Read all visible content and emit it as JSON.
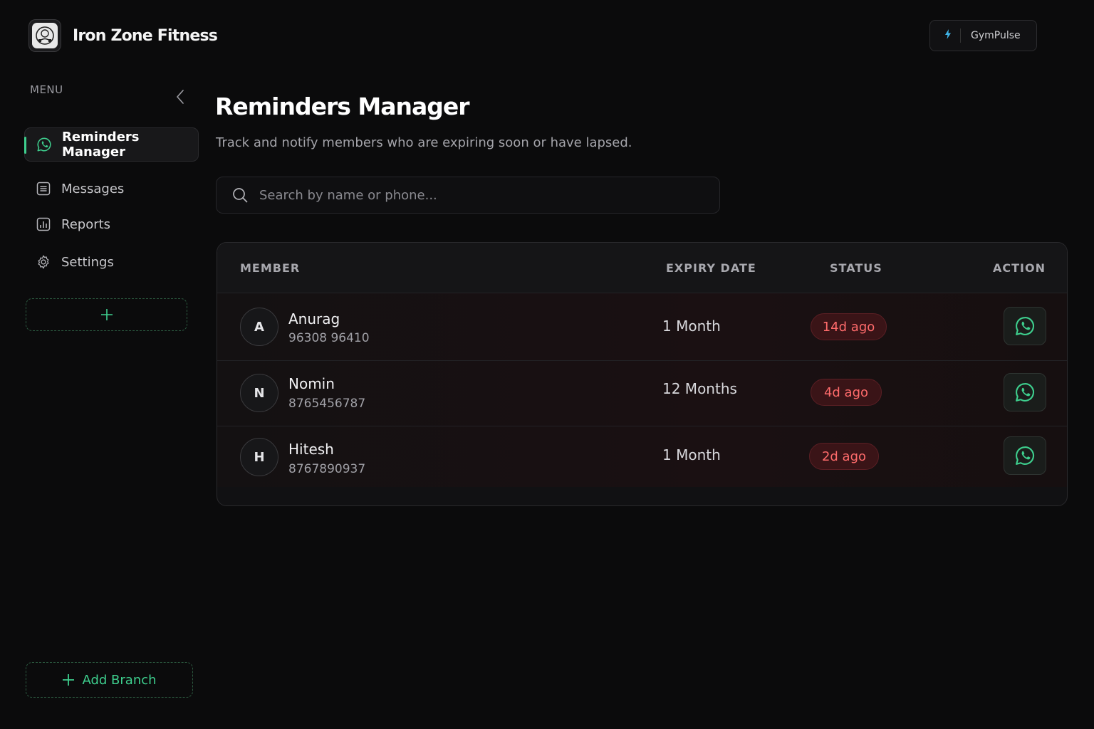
{
  "brand": {
    "name": "Iron Zone Fitness"
  },
  "top_badge": {
    "icon": "bolt-icon",
    "label": "GymPulse"
  },
  "sidebar": {
    "menu_label": "MENU",
    "items": [
      {
        "label": "Reminders Manager",
        "icon": "whatsapp-icon",
        "active": true
      },
      {
        "label": "Messages",
        "icon": "document-icon",
        "active": false
      },
      {
        "label": "Reports",
        "icon": "bar-chart-icon",
        "active": false
      },
      {
        "label": "Settings",
        "icon": "gear-icon",
        "active": false
      }
    ],
    "add_branch_label": "Add Branch"
  },
  "main": {
    "title": "Reminders Manager",
    "subtitle": "Track and notify members who are expiring soon or have lapsed.",
    "search": {
      "placeholder": "Search by name or phone..."
    }
  },
  "table": {
    "columns": [
      "MEMBER",
      "EXPIRY DATE",
      "STATUS",
      "ACTION"
    ],
    "rows": [
      {
        "initial": "A",
        "name": "Anurag",
        "phone": "96308 96410",
        "expiry": "1 Month",
        "status": "14d ago"
      },
      {
        "initial": "N",
        "name": "Nomin",
        "phone": "8765456787",
        "expiry": "12 Months",
        "status": "4d ago"
      },
      {
        "initial": "H",
        "name": "Hitesh",
        "phone": "8767890937",
        "expiry": "1 Month",
        "status": "2d ago"
      }
    ]
  },
  "colors": {
    "accent": "#3ecf8e",
    "status_text": "#ff6b6b",
    "status_bg": "#3a1417",
    "background": "#0b0b0c"
  }
}
